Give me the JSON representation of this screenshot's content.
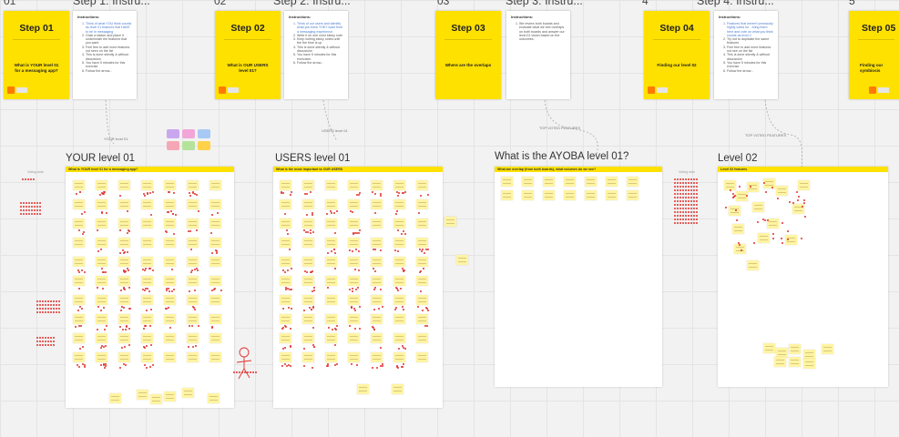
{
  "headers": [
    {
      "num": "01",
      "title": "Step 1: Instru..."
    },
    {
      "num": "02",
      "title": "Step 2: Instru..."
    },
    {
      "num": "03",
      "title": "Step 3: Instru..."
    },
    {
      "num": "4",
      "title": "Step 4: Instru..."
    },
    {
      "num": "5"
    }
  ],
  "steps": [
    {
      "title": "Step 01",
      "question": "What is YOUR level 01 for a messaging app?"
    },
    {
      "title": "Step 02",
      "question": "What is OUR USERS level 01?"
    },
    {
      "title": "Step 03",
      "question": "Where are the overlaps"
    },
    {
      "title": "Step 04",
      "question": "Finding our level 02"
    },
    {
      "title": "Step 05",
      "question": "Finding our symbiosis"
    }
  ],
  "instructions": [
    {
      "heading": "Instructions:",
      "items": [
        "Think of what YOU think counts as level 01 features that HAVE to be in messaging",
        "Grab a sticker and place it underneath the features that you want",
        "Feel free to add more features not seen on the list",
        "This is done silently & without discussion",
        "You have 5 minutes for this exercise",
        "Follow the arrow..."
      ]
    },
    {
      "heading": "Instructions:",
      "items": [
        "Think of our users and identify what you think THEY want from a messaging experience.",
        "Write it on one color sticky note",
        "Keep writing sticky notes until the the time is up",
        "This is done silently & without discussion",
        "You have 5 minutes for this exercises",
        "Follow the arrow..."
      ]
    },
    {
      "heading": "Instructions:",
      "items": [
        "We review both boards and evaluate what we see overlaps on both boards and answer our level 01 vision based on the outcomes."
      ]
    },
    {
      "heading": "Instructions:",
      "items": [
        "Features that weren't previously highly voted for - bring them here and vote on what you think counts as level 2",
        "Try not to duplicate the same features",
        "Feel free to add more features not see on the list",
        "This is done silently & without discussion",
        "You have 5 minutes for this exercise",
        "Follow the arrow..."
      ]
    }
  ],
  "boards": [
    {
      "title": "YOUR level 01",
      "header": "What is YOUR level 01 for a messaging app?"
    },
    {
      "title": "USERS level 01",
      "header": "What is the most important to OUR USERS"
    },
    {
      "title": "What is the AYOBA level 01?",
      "header": "What are overlap (from both boards), what volumes do we see?"
    },
    {
      "title": "Level 02",
      "header": "Level 02 features"
    }
  ],
  "connectors": {
    "your_level": "YOUR level 01",
    "users_level": "USERS level 01",
    "top_voted_1": "TOP VOTED FEATURES",
    "top_voted_2": "TOP VOTED FEATURES"
  },
  "side_labels": {
    "voting_dots_1": "Voting dots",
    "voting_dots_2": "Voting dots"
  },
  "colors": {
    "yellow": "#ffe100",
    "note": "#fff4a3",
    "dot": "#e0322e",
    "icon": "#ff7a00"
  }
}
